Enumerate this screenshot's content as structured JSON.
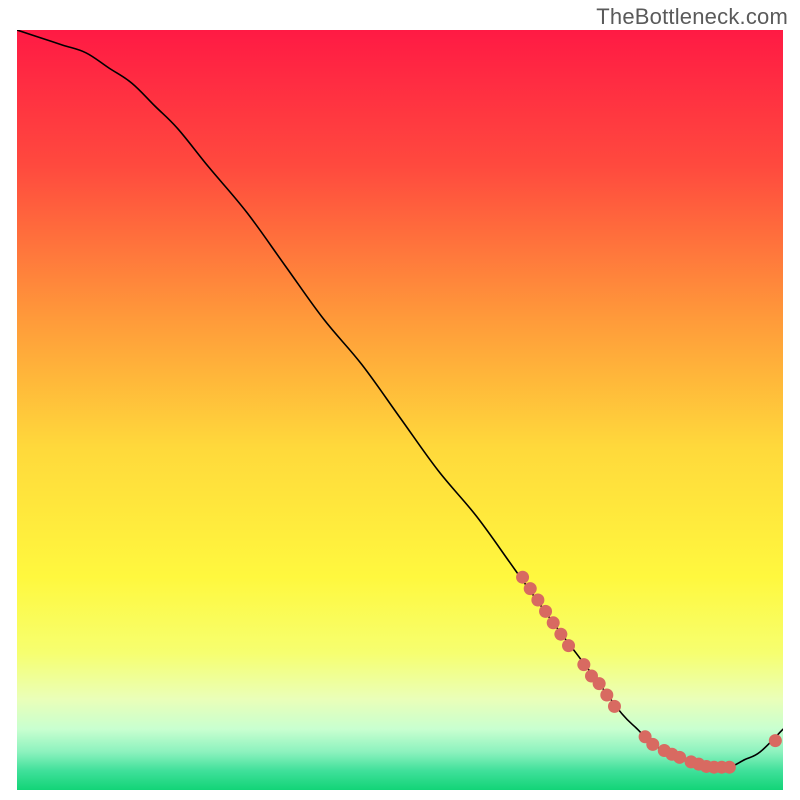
{
  "watermark": "TheBottleneck.com",
  "colors": {
    "gradient_top": "#ff1a44",
    "gradient_mid_upper": "#ff7a3a",
    "gradient_mid": "#ffd93b",
    "gradient_lower_yellow": "#f8ff6e",
    "gradient_pale": "#e9ffcf",
    "gradient_bottom": "#12d477",
    "curve": "#000000",
    "marker": "#d86a61"
  },
  "chart_data": {
    "type": "line",
    "title": "",
    "xlabel": "",
    "ylabel": "",
    "xlim": [
      0,
      100
    ],
    "ylim": [
      0,
      100
    ],
    "series": [
      {
        "name": "bottleneck-curve",
        "x": [
          0,
          3,
          6,
          9,
          12,
          15,
          18,
          21,
          25,
          30,
          35,
          40,
          45,
          50,
          55,
          60,
          65,
          70,
          73,
          76,
          79,
          81,
          83,
          85,
          87,
          89,
          91,
          93,
          95,
          97,
          100
        ],
        "values": [
          100,
          99,
          98,
          97,
          95,
          93,
          90,
          87,
          82,
          76,
          69,
          62,
          56,
          49,
          42,
          36,
          29,
          22,
          18,
          14,
          10,
          8,
          6,
          5,
          4,
          3,
          3,
          3,
          4,
          5,
          8
        ]
      }
    ],
    "markers": {
      "name": "highlight-dots",
      "points": [
        {
          "x": 66,
          "y": 28
        },
        {
          "x": 67,
          "y": 26.5
        },
        {
          "x": 68,
          "y": 25
        },
        {
          "x": 69,
          "y": 23.5
        },
        {
          "x": 70,
          "y": 22
        },
        {
          "x": 71,
          "y": 20.5
        },
        {
          "x": 72,
          "y": 19
        },
        {
          "x": 74,
          "y": 16.5
        },
        {
          "x": 75,
          "y": 15
        },
        {
          "x": 76,
          "y": 14
        },
        {
          "x": 77,
          "y": 12.5
        },
        {
          "x": 78,
          "y": 11
        },
        {
          "x": 82,
          "y": 7
        },
        {
          "x": 83,
          "y": 6
        },
        {
          "x": 84.5,
          "y": 5.2
        },
        {
          "x": 85.5,
          "y": 4.7
        },
        {
          "x": 86.5,
          "y": 4.3
        },
        {
          "x": 88,
          "y": 3.7
        },
        {
          "x": 89,
          "y": 3.4
        },
        {
          "x": 90,
          "y": 3.1
        },
        {
          "x": 91,
          "y": 3
        },
        {
          "x": 92,
          "y": 3
        },
        {
          "x": 93,
          "y": 3
        },
        {
          "x": 99,
          "y": 6.5
        }
      ]
    }
  }
}
